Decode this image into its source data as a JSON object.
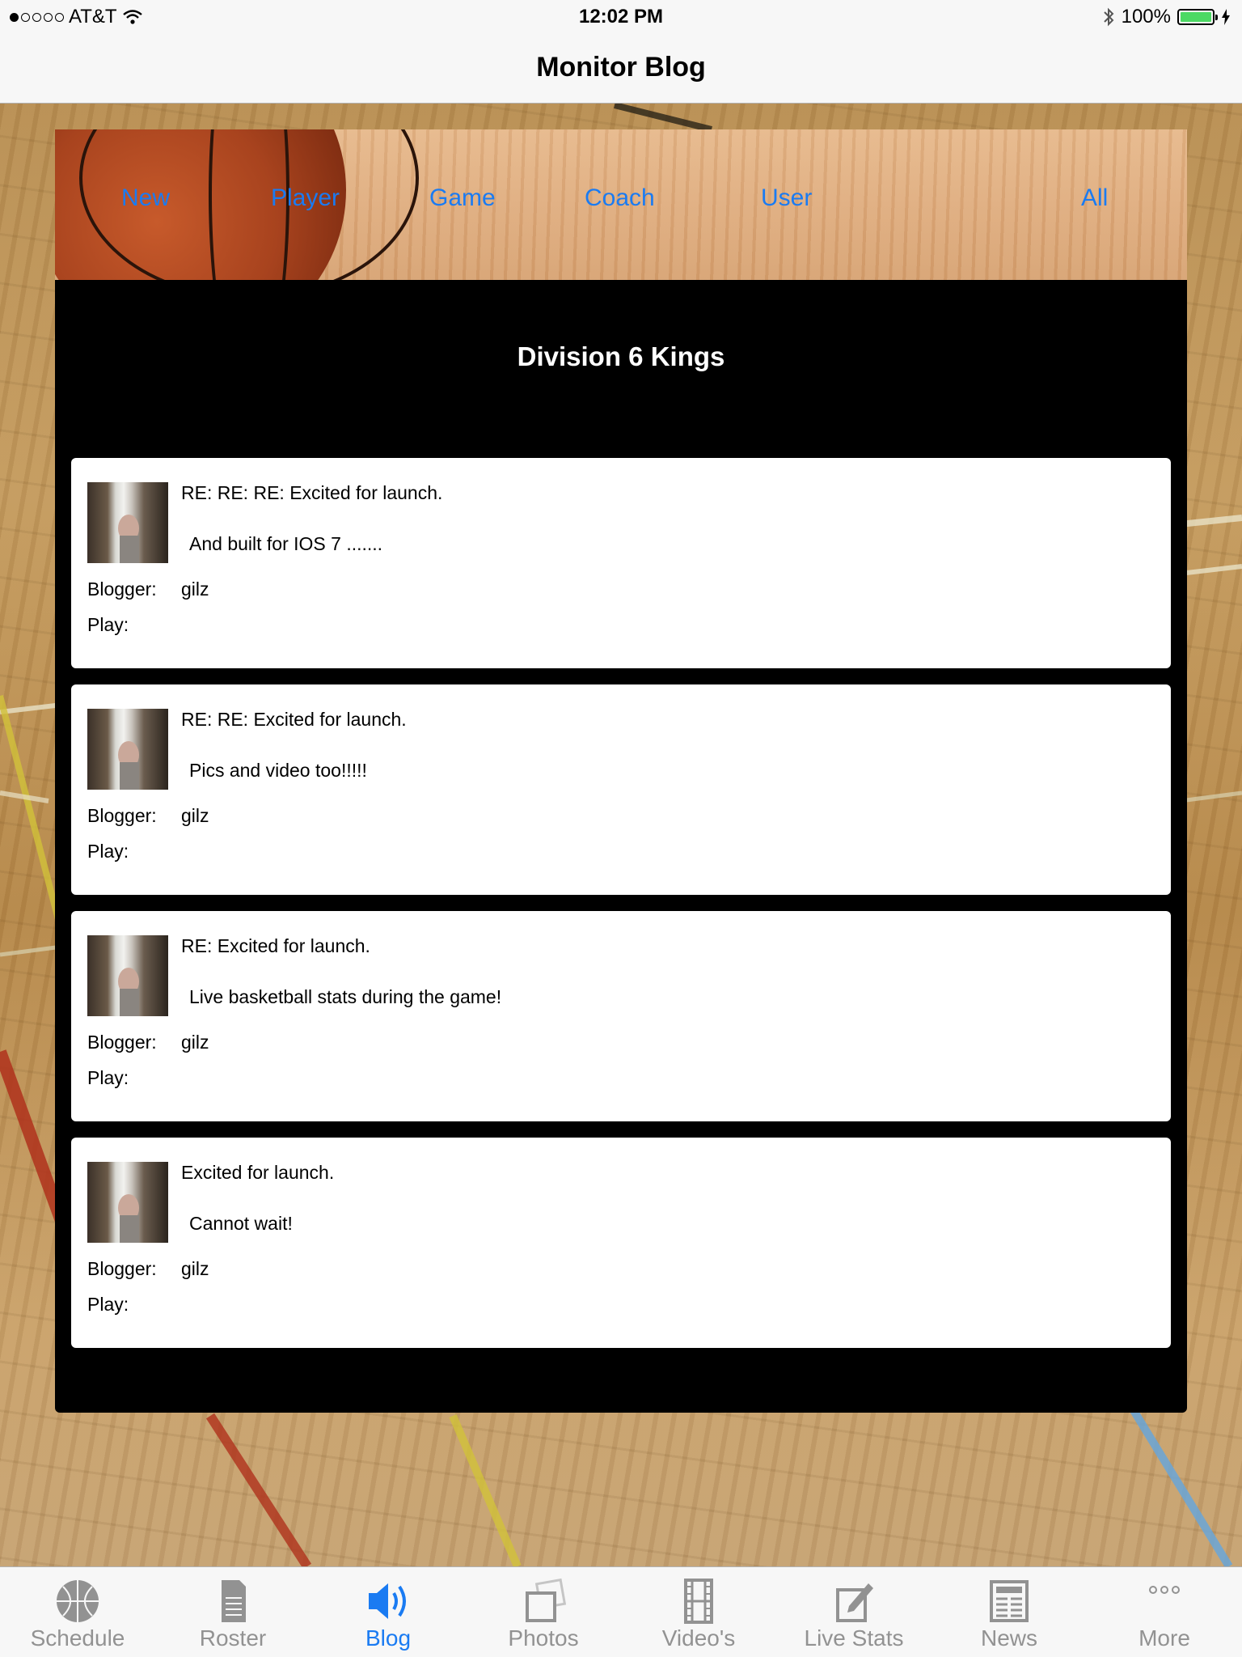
{
  "status_bar": {
    "carrier": "AT&T",
    "time": "12:02 PM",
    "battery": "100%",
    "signal_dots_filled": 1,
    "signal_dots_total": 5
  },
  "nav": {
    "title": "Monitor Blog"
  },
  "filters": {
    "items": [
      {
        "label": "New"
      },
      {
        "label": "Player"
      },
      {
        "label": "Game"
      },
      {
        "label": "Coach"
      },
      {
        "label": "User"
      },
      {
        "label": "All"
      }
    ]
  },
  "team": {
    "name": "Division 6 Kings"
  },
  "labels": {
    "blogger": "Blogger:",
    "play": "Play:"
  },
  "posts": [
    {
      "subject": "RE: RE: RE: Excited for launch.",
      "body": "And built for IOS 7 .......",
      "blogger": "gilz",
      "play": ""
    },
    {
      "subject": "RE: RE: Excited for launch.",
      "body": "Pics and video too!!!!!",
      "blogger": "gilz",
      "play": ""
    },
    {
      "subject": "RE: Excited for launch.",
      "body": "Live basketball stats during the game!",
      "blogger": "gilz",
      "play": ""
    },
    {
      "subject": "Excited for launch.",
      "body": "Cannot wait!",
      "blogger": "gilz",
      "play": ""
    }
  ],
  "tabbar": {
    "items": [
      {
        "label": "Schedule",
        "icon": "basketball-icon"
      },
      {
        "label": "Roster",
        "icon": "document-icon"
      },
      {
        "label": "Blog",
        "icon": "speaker-icon",
        "active": true
      },
      {
        "label": "Photos",
        "icon": "photos-icon"
      },
      {
        "label": "Video's",
        "icon": "film-icon"
      },
      {
        "label": "Live Stats",
        "icon": "edit-icon"
      },
      {
        "label": "News",
        "icon": "newspaper-icon"
      },
      {
        "label": "More",
        "icon": "more-icon"
      }
    ]
  },
  "colors": {
    "accent": "#1a7bf2",
    "inactive": "#929292",
    "panel": "#000000",
    "battery": "#4cd964"
  }
}
